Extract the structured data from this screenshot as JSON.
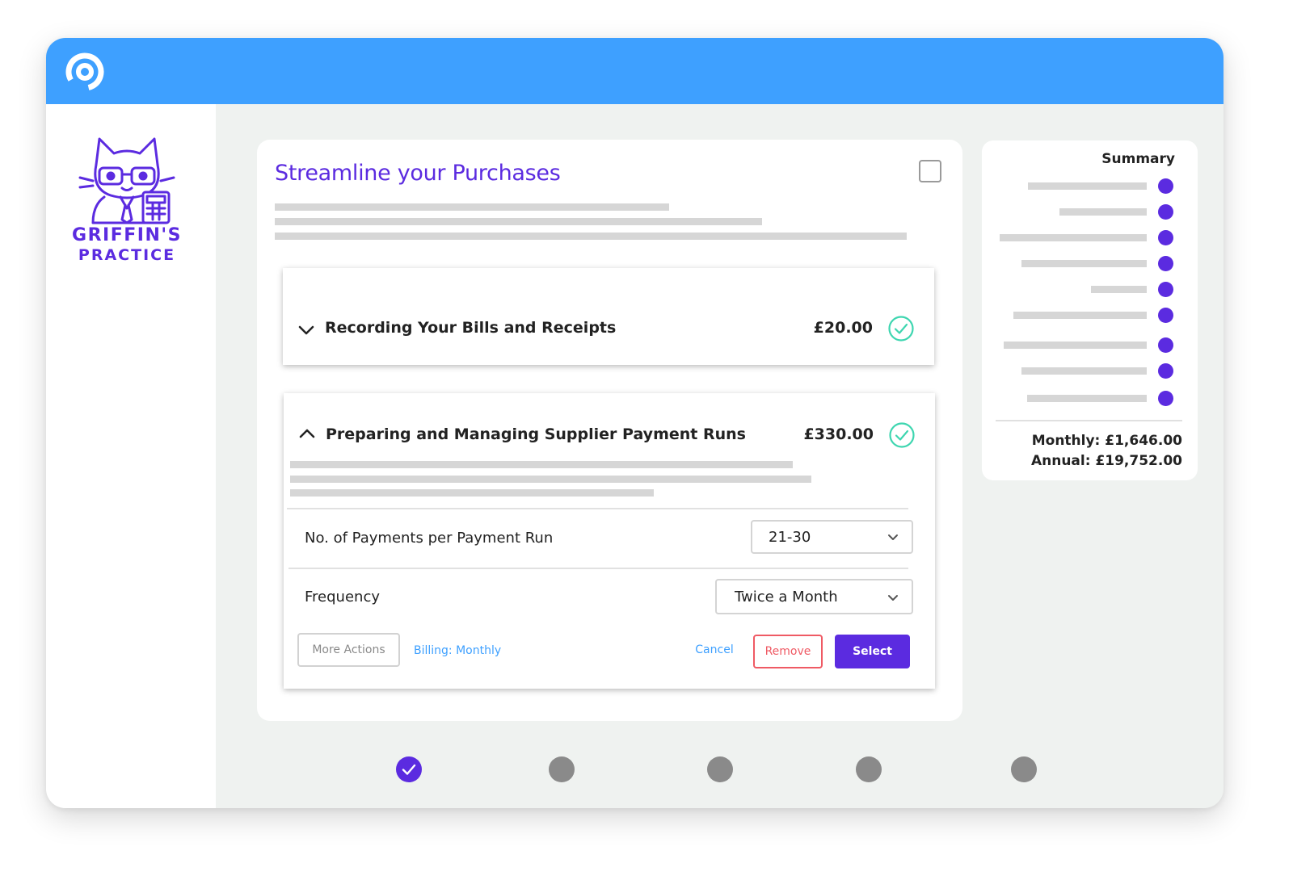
{
  "colors": {
    "accent": "#5b2be0",
    "topbar": "#3ea0ff",
    "link": "#3ea0ff",
    "danger": "#ef5a64",
    "success": "#3ed6b0",
    "step_pending": "#8a8a8a"
  },
  "brand": {
    "icon": "brand-logo-icon"
  },
  "practice": {
    "name_line1": "GRIFFIN'S",
    "name_line2": "PRACTICE",
    "icon": "cat-accountant-logo"
  },
  "card": {
    "title": "Streamline your Purchases",
    "services": [
      {
        "title": "Recording Your Bills and Receipts",
        "price": "£20.00",
        "expanded": false,
        "selected": true
      },
      {
        "title": "Preparing and Managing Supplier Payment Runs",
        "price": "£330.00",
        "expanded": true,
        "selected": true,
        "options": [
          {
            "label": "No. of Payments per Payment Run",
            "value": "21-30"
          },
          {
            "label": "Frequency",
            "value": "Twice a Month"
          }
        ],
        "actions": {
          "more": "More Actions",
          "billing": "Billing: Monthly",
          "cancel": "Cancel",
          "remove": "Remove",
          "select": "Select"
        }
      }
    ]
  },
  "summary": {
    "title": "Summary",
    "monthly": "Monthly: £1,646.00",
    "annual": "Annual: £19,752.00"
  },
  "steps": {
    "total": 5,
    "completed": 1
  }
}
